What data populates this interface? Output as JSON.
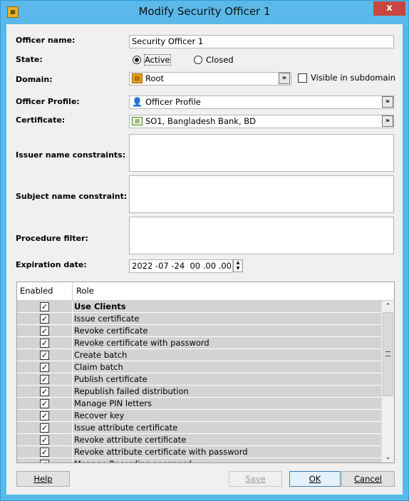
{
  "window": {
    "title": "Modify Security Officer 1",
    "app_icon": "certificate-manager-icon",
    "close_glyph": "x"
  },
  "form": {
    "officer_name": {
      "label": "Officer name:",
      "value": "Security Officer 1"
    },
    "state": {
      "label": "State:",
      "options": [
        "Active",
        "Closed"
      ],
      "selected": "Active"
    },
    "domain": {
      "label": "Domain:",
      "value": "Root",
      "icon": "bank-icon",
      "browse": "»",
      "visible_in_subdomain_label": "Visible in subdomain",
      "visible_in_subdomain_checked": false
    },
    "officer_profile": {
      "label": "Officer Profile:",
      "value": "Officer Profile",
      "icon": "user-profile-icon",
      "browse": "»"
    },
    "certificate": {
      "label": "Certificate:",
      "value": "SO1, Bangladesh Bank, BD",
      "icon": "certificate-icon",
      "browse": "»"
    },
    "issuer_name_constraints": {
      "label": "Issuer name constraints:",
      "value": ""
    },
    "subject_name_constraint": {
      "label": "Subject name constraint:",
      "value": ""
    },
    "procedure_filter": {
      "label": "Procedure filter:",
      "value": ""
    },
    "expiration_date": {
      "label": "Expiration date:",
      "value": "2022 -07 -24  00 .00 .00"
    }
  },
  "roles_table": {
    "columns": [
      "Enabled",
      "Role"
    ],
    "rows": [
      {
        "enabled": true,
        "role": "Use Clients"
      },
      {
        "enabled": true,
        "role": "Issue certificate"
      },
      {
        "enabled": true,
        "role": "Revoke certificate"
      },
      {
        "enabled": true,
        "role": "Revoke certificate with password"
      },
      {
        "enabled": true,
        "role": "Create batch"
      },
      {
        "enabled": true,
        "role": "Claim batch"
      },
      {
        "enabled": true,
        "role": "Publish certificate"
      },
      {
        "enabled": true,
        "role": "Republish failed distribution"
      },
      {
        "enabled": true,
        "role": "Manage PIN letters"
      },
      {
        "enabled": true,
        "role": "Recover key"
      },
      {
        "enabled": true,
        "role": "Issue attribute certificate"
      },
      {
        "enabled": true,
        "role": "Revoke attribute certificate"
      },
      {
        "enabled": true,
        "role": "Revoke attribute certificate with password"
      },
      {
        "enabled": true,
        "role": "Manage Recording password"
      }
    ]
  },
  "buttons": {
    "help": "Help",
    "save": "Save",
    "ok": "OK",
    "cancel": "Cancel"
  },
  "colors": {
    "title_bar": "#5ab9ea",
    "close": "#c7463e",
    "row_bg": "#d3d3d3"
  }
}
